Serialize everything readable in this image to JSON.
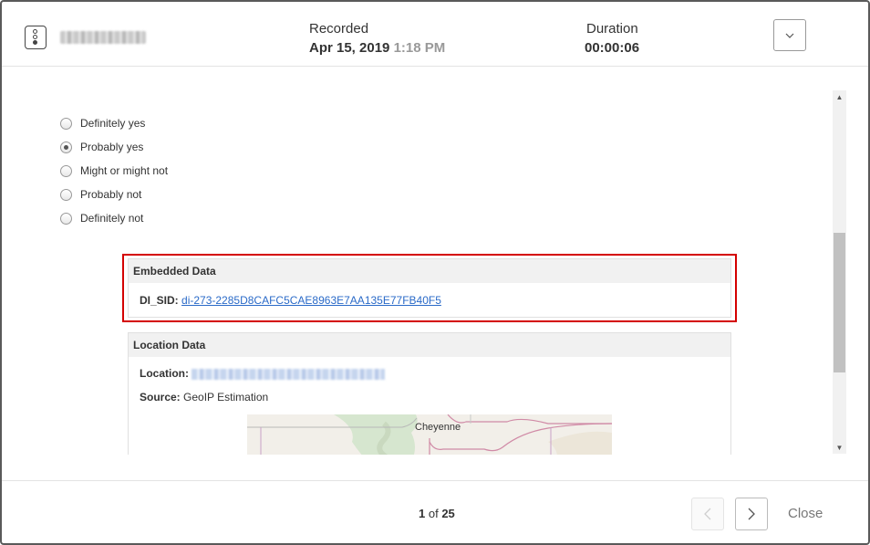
{
  "header": {
    "recorded_label": "Recorded",
    "recorded_date": "Apr 15, 2019",
    "recorded_time": "1:18 PM",
    "duration_label": "Duration",
    "duration_value": "00:00:06",
    "expand_icon": "chevron-down-icon"
  },
  "question": {
    "options": [
      {
        "label": "Definitely yes",
        "selected": false
      },
      {
        "label": "Probably yes",
        "selected": true
      },
      {
        "label": "Might or might not",
        "selected": false
      },
      {
        "label": "Probably not",
        "selected": false
      },
      {
        "label": "Definitely not",
        "selected": false
      }
    ]
  },
  "embedded_data": {
    "title": "Embedded Data",
    "key": "DI_SID:",
    "value": "di-273-2285D8CAFC5CAE8963E7AA135E77FB40F5"
  },
  "location_data": {
    "title": "Location Data",
    "location_label": "Location:",
    "source_label": "Source:",
    "source_value": "GeoIP Estimation",
    "map_city": "Cheyenne"
  },
  "footer": {
    "current": "1",
    "of_text": "of",
    "total": "25",
    "prev_icon": "chevron-left-icon",
    "next_icon": "chevron-right-icon",
    "close_label": "Close"
  },
  "colors": {
    "highlight": "#d40000",
    "link": "#2a6ac8"
  }
}
